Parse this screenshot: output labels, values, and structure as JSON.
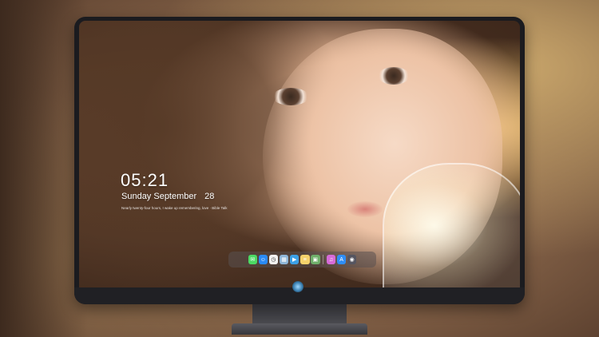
{
  "lock_screen": {
    "time": "05:21",
    "weekday_month": "Sunday September",
    "day": "28",
    "quote": "Nearly twenty-four hours, I wake up remembering, love · Bible Talk"
  },
  "dock": {
    "apps": [
      {
        "name": "messages",
        "icon": "messages-icon",
        "glyph": "✉",
        "color": "#4cd964"
      },
      {
        "name": "finder",
        "icon": "finder-icon",
        "glyph": "☺",
        "color": "#2a8af6"
      },
      {
        "name": "clock",
        "icon": "clock-icon",
        "glyph": "◷",
        "color": "#f2f2f2"
      },
      {
        "name": "preview",
        "icon": "preview-icon",
        "glyph": "▦",
        "color": "#8fb6d8"
      },
      {
        "name": "movie",
        "icon": "clapper-icon",
        "glyph": "▶",
        "color": "#3ca0e6"
      },
      {
        "name": "notes",
        "icon": "notes-icon",
        "glyph": "≡",
        "color": "#f5d26b"
      },
      {
        "name": "photo",
        "icon": "photo-icon",
        "glyph": "▣",
        "color": "#6fae6a"
      },
      {
        "name": "music",
        "icon": "music-icon",
        "glyph": "♫",
        "color": "#d66bd8"
      },
      {
        "name": "app-store",
        "icon": "appstore-icon",
        "glyph": "A",
        "color": "#2f8ef6"
      },
      {
        "name": "camera",
        "icon": "camera-icon",
        "glyph": "◉",
        "color": "#555560"
      }
    ]
  },
  "colors": {
    "bezel": "#1b1b1f",
    "dock_bg": "rgba(90,80,80,0.55)",
    "text": "#ffffff"
  }
}
